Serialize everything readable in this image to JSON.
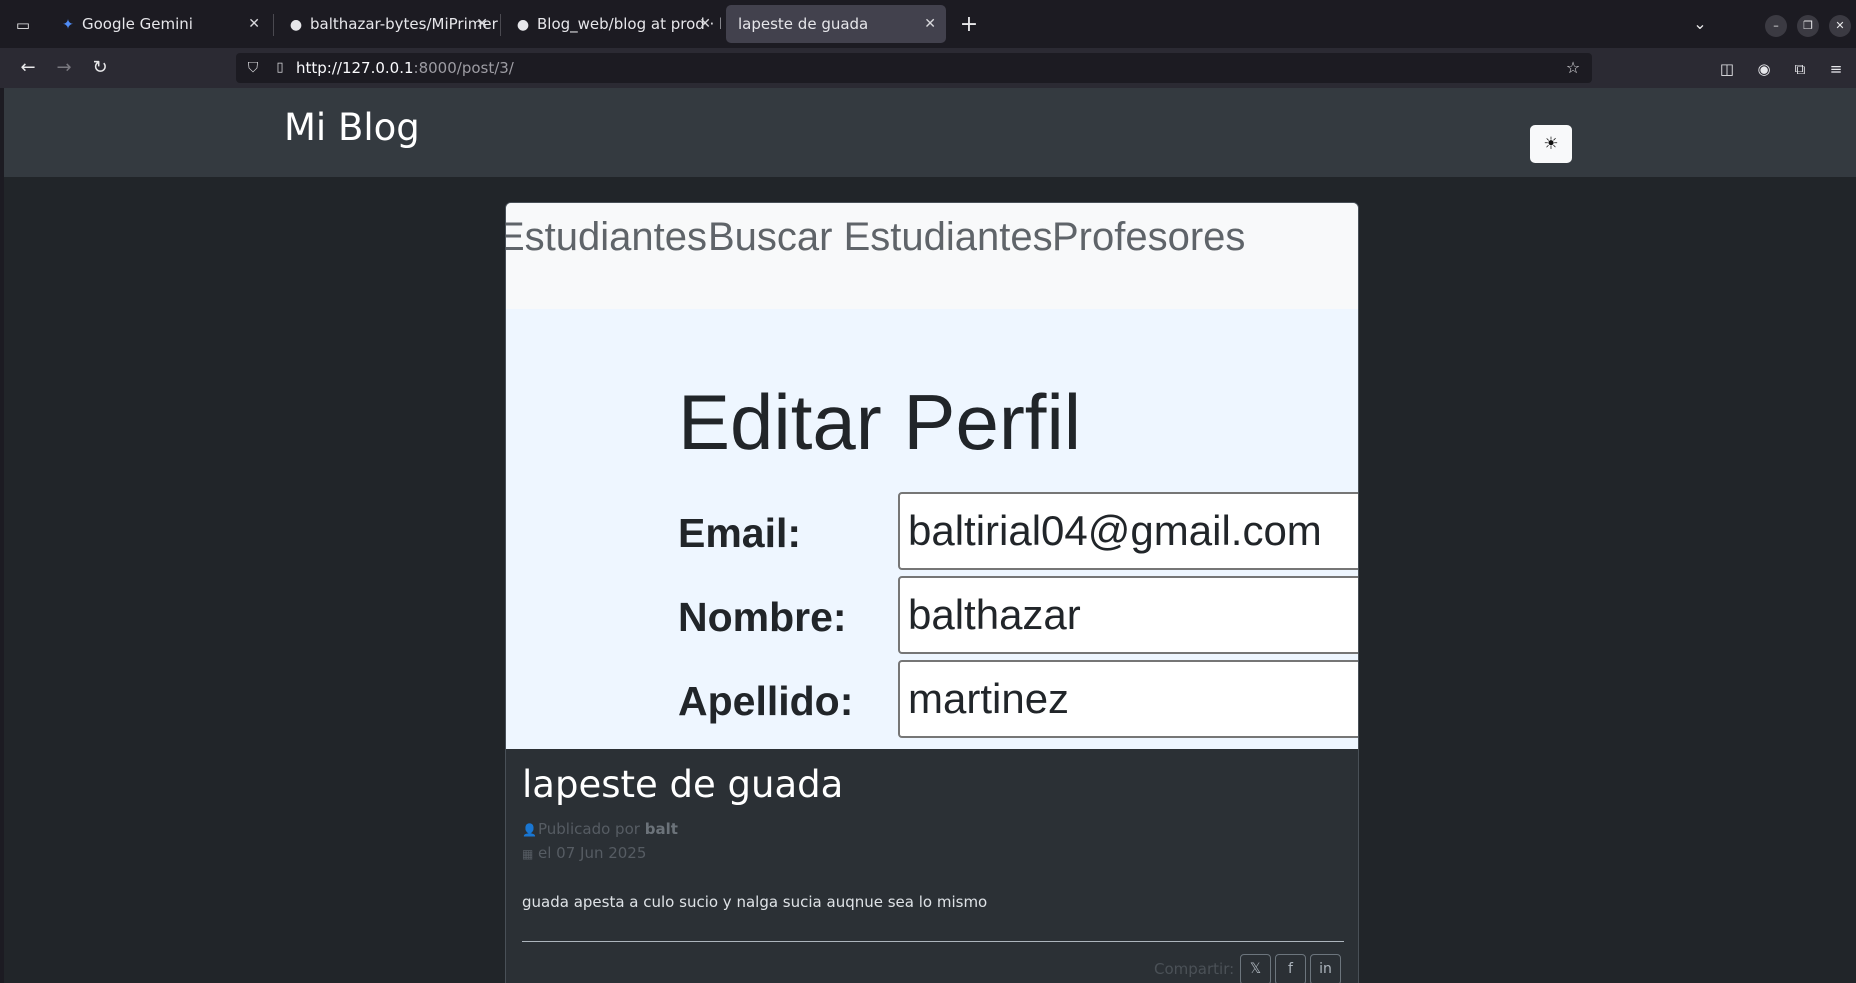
{
  "browser": {
    "tabs": [
      {
        "title": "Google Gemini",
        "icon": "gemini-sparkle-icon"
      },
      {
        "title": "balthazar-bytes/MiPrimer",
        "icon": "github-icon"
      },
      {
        "title": "Blog_web/blog at prod · b",
        "icon": "github-icon"
      },
      {
        "title": "lapeste de guada",
        "icon": "",
        "active": true
      }
    ],
    "url_host": "http://127.0.0.1",
    "url_rest": ":8000/post/3/"
  },
  "site": {
    "brand": "Mi Blog",
    "theme_toggle": "☀"
  },
  "post": {
    "image": {
      "nav_items": [
        "Estudiantes",
        "Buscar Estudiantes",
        "Profesores"
      ],
      "heading": "Editar Perfil",
      "fields": [
        {
          "label": "Email:",
          "value": "baltirial04@gmail.com"
        },
        {
          "label": "Nombre:",
          "value": "balthazar"
        },
        {
          "label": "Apellido:",
          "value": "martinez"
        }
      ]
    },
    "title": "lapeste de guada",
    "published_by_prefix": "Publicado por",
    "author": "balt",
    "date": "el 07 Jun 2025",
    "body": "guada apesta a culo sucio y nalga sucia auqnue sea lo mismo",
    "share_label": "Compartir:",
    "share_buttons": [
      "x-icon",
      "facebook-icon",
      "linkedin-icon"
    ]
  }
}
